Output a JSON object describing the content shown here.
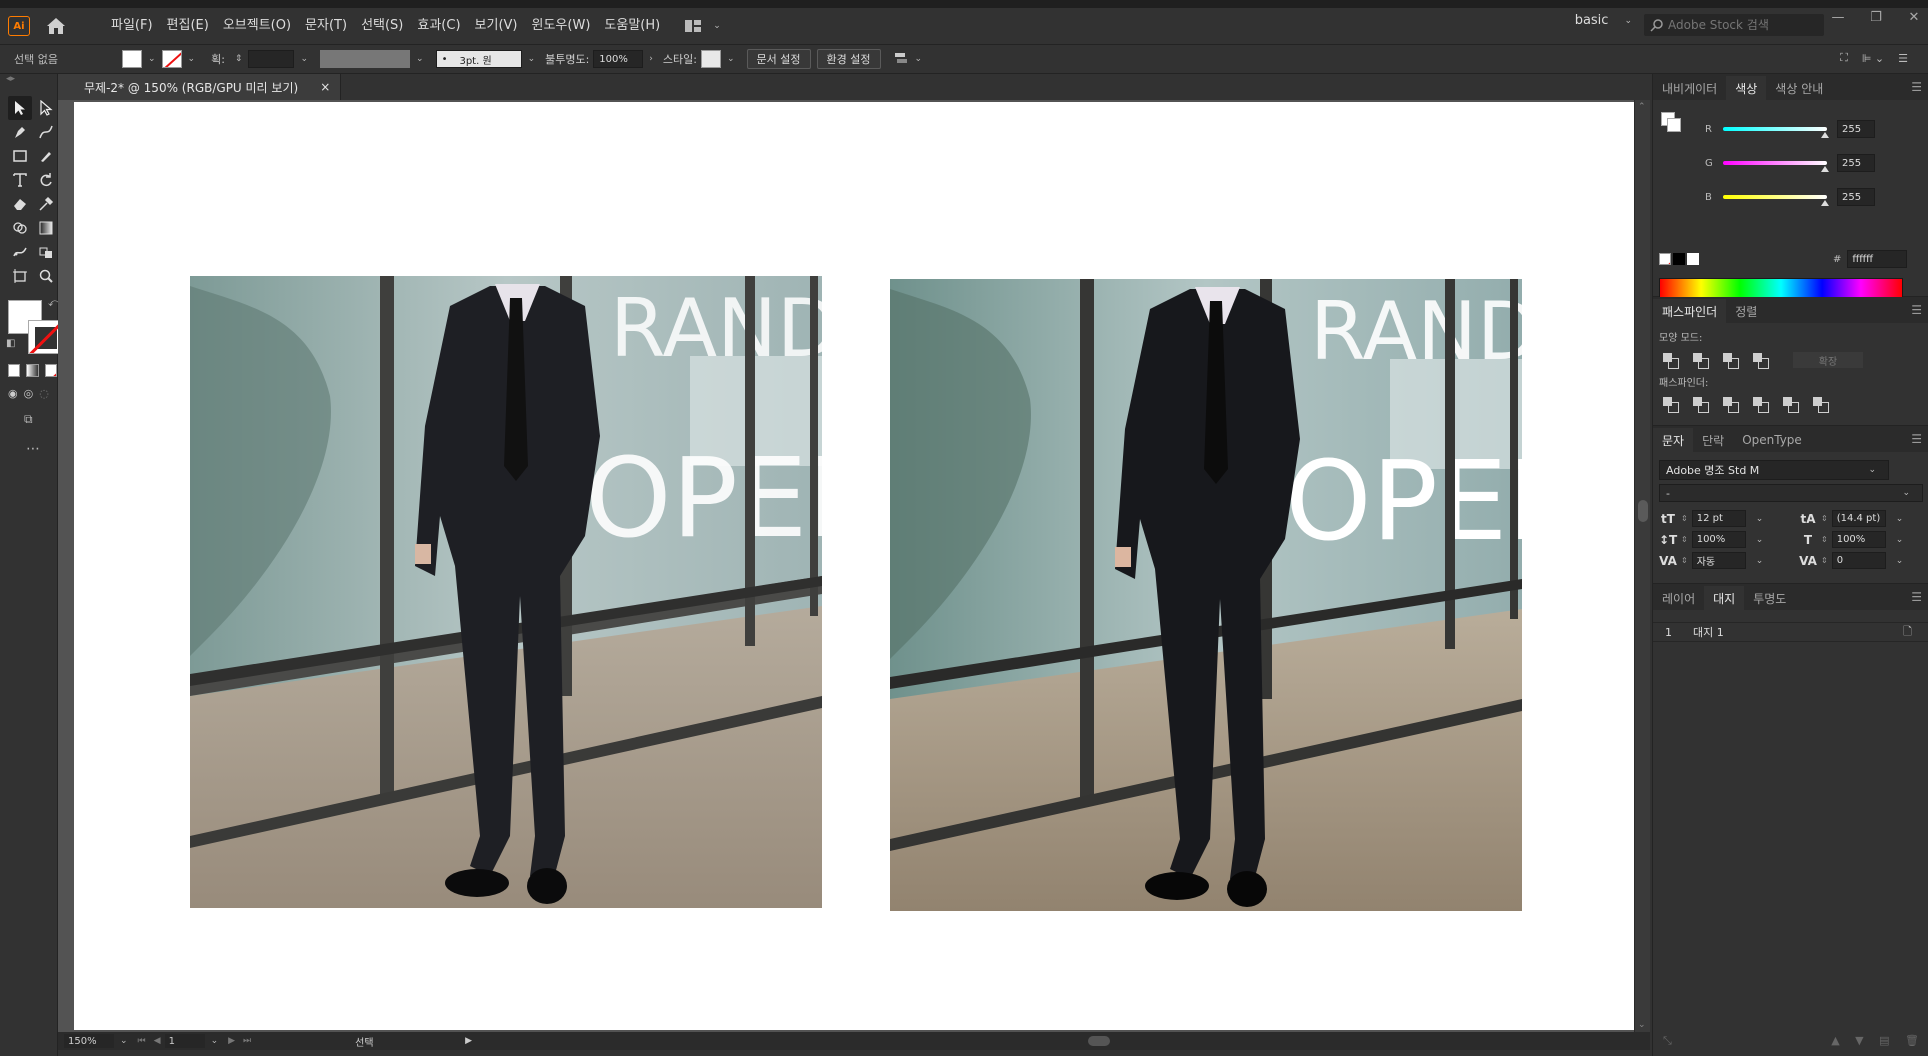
{
  "app": {
    "logo": "Ai",
    "menu": [
      "파일(F)",
      "편집(E)",
      "오브젝트(O)",
      "문자(T)",
      "선택(S)",
      "효과(C)",
      "보기(V)",
      "윈도우(W)",
      "도움말(H)"
    ],
    "workspace": "basic",
    "stock_search_placeholder": "Adobe Stock 검색"
  },
  "control_bar": {
    "selection": "선택 없음",
    "stroke_label": "획:",
    "brush": "3pt. 원",
    "opacity_label": "불투명도:",
    "opacity": "100%",
    "style_label": "스타일:",
    "doc_setup_button": "문서 설정",
    "prefs_button": "환경 설정"
  },
  "document": {
    "tab_title": "무제-2* @ 150% (RGB/GPU 미리 보기)",
    "close_symbol": "×"
  },
  "status_bar": {
    "zoom": "150%",
    "artboard_number": "1",
    "tool": "선택"
  },
  "panels": {
    "color_tabs": [
      "내비게이터",
      "색상",
      "색상 안내"
    ],
    "color": {
      "r_label": "R",
      "r": "255",
      "g_label": "G",
      "g": "255",
      "b_label": "B",
      "b": "255",
      "hash": "#",
      "hex": "ffffff"
    },
    "pathfinder_tabs": [
      "패스파인더",
      "정렬"
    ],
    "shape_modes_label": "모양 모드:",
    "expand_button": "확장",
    "pathfinders_label": "패스파인더:",
    "char_tabs": [
      "문자",
      "단락",
      "OpenType"
    ],
    "character": {
      "font": "Adobe 명조 Std M",
      "style": "-",
      "size": "12 pt",
      "leading": "(14.4 pt)",
      "vscale": "100%",
      "hscale": "100%",
      "kerning": "자동",
      "tracking": "0"
    },
    "artboard_tabs": [
      "레이어",
      "대지",
      "투명도"
    ],
    "artboards": [
      {
        "num": "1",
        "name": "대지 1"
      }
    ]
  },
  "icons": {
    "home": "home-icon",
    "selection": "selection-tool-icon",
    "direct_selection": "direct-selection-tool-icon",
    "pen": "pen-tool-icon",
    "type": "type-tool-icon",
    "zoom": "zoom-tool-icon",
    "eyedropper": "eyedropper-tool-icon",
    "search": "search-icon"
  },
  "colors": {
    "accent_orange": "#ff7c00",
    "ui_dark": "#323232",
    "canvas_gray": "#535353",
    "artboard": "#ffffff"
  }
}
